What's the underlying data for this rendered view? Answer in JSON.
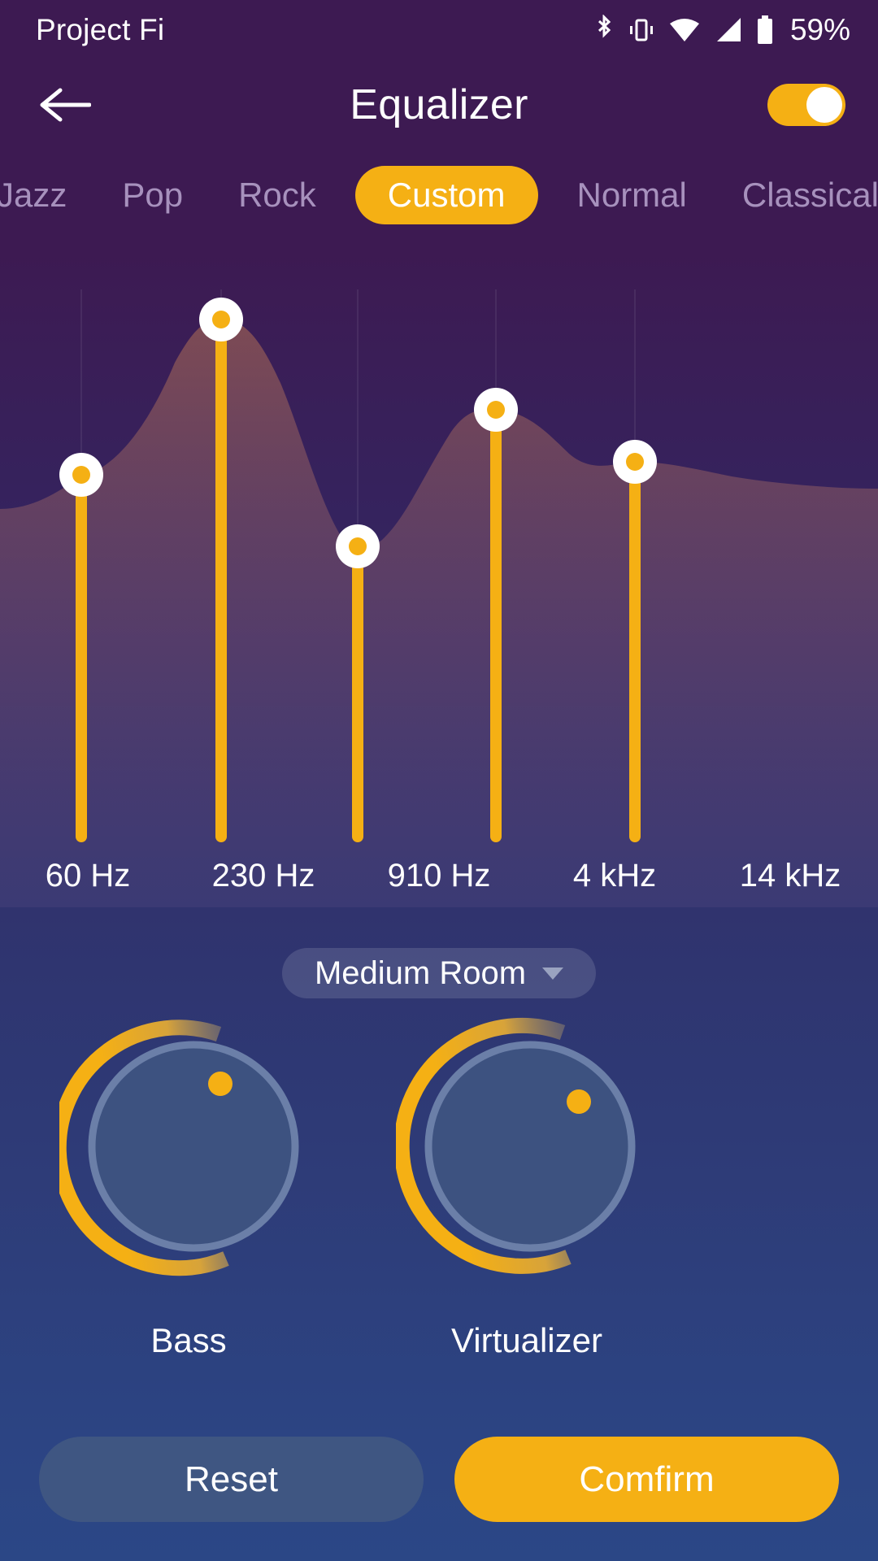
{
  "statusbar": {
    "carrier": "Project Fi",
    "battery_percent": "59%",
    "icons": [
      "bluetooth-icon",
      "vibrate-icon",
      "wifi-icon",
      "cellular-signal-icon",
      "battery-icon"
    ]
  },
  "appbar": {
    "title": "Equalizer",
    "back_icon": "back-arrow-icon",
    "toggle_on": true
  },
  "tabs": {
    "items": [
      {
        "label": "Jazz",
        "active": false
      },
      {
        "label": "Pop",
        "active": false
      },
      {
        "label": "Rock",
        "active": false
      },
      {
        "label": "Custom",
        "active": true
      },
      {
        "label": "Normal",
        "active": false
      },
      {
        "label": "Classical",
        "active": false
      }
    ]
  },
  "equalizer": {
    "bands": [
      {
        "freq_label": "60 Hz",
        "level": 0.46
      },
      {
        "freq_label": "230 Hz",
        "level": 0.84
      },
      {
        "freq_label": "910 Hz",
        "level": 0.32
      },
      {
        "freq_label": "4 kHz",
        "level": 0.68
      },
      {
        "freq_label": "14 kHz",
        "level": 0.58
      }
    ]
  },
  "reverb": {
    "value": "Medium Room",
    "caret_icon": "chevron-down-icon"
  },
  "knobs": [
    {
      "name": "Bass",
      "value": 0.3
    },
    {
      "name": "Virtualizer",
      "value": 0.38
    }
  ],
  "buttons": {
    "reset": "Reset",
    "confirm": "Comfirm"
  },
  "colors": {
    "accent": "#f5b014",
    "header_bg": "#3d1a52",
    "tab_inactive": "#a791bd",
    "knob_face": "#3d5280",
    "knob_ring": "#6b7fa8",
    "reset_bg": "#3f5682"
  },
  "chart_data": {
    "type": "area",
    "title": "",
    "xlabel": "",
    "ylabel": "",
    "categories": [
      "60 Hz",
      "230 Hz",
      "910 Hz",
      "4 kHz",
      "14 kHz"
    ],
    "values": [
      0.46,
      0.84,
      0.32,
      0.68,
      0.58
    ],
    "ylim": [
      0,
      1
    ],
    "grid": true,
    "legend": "none"
  }
}
